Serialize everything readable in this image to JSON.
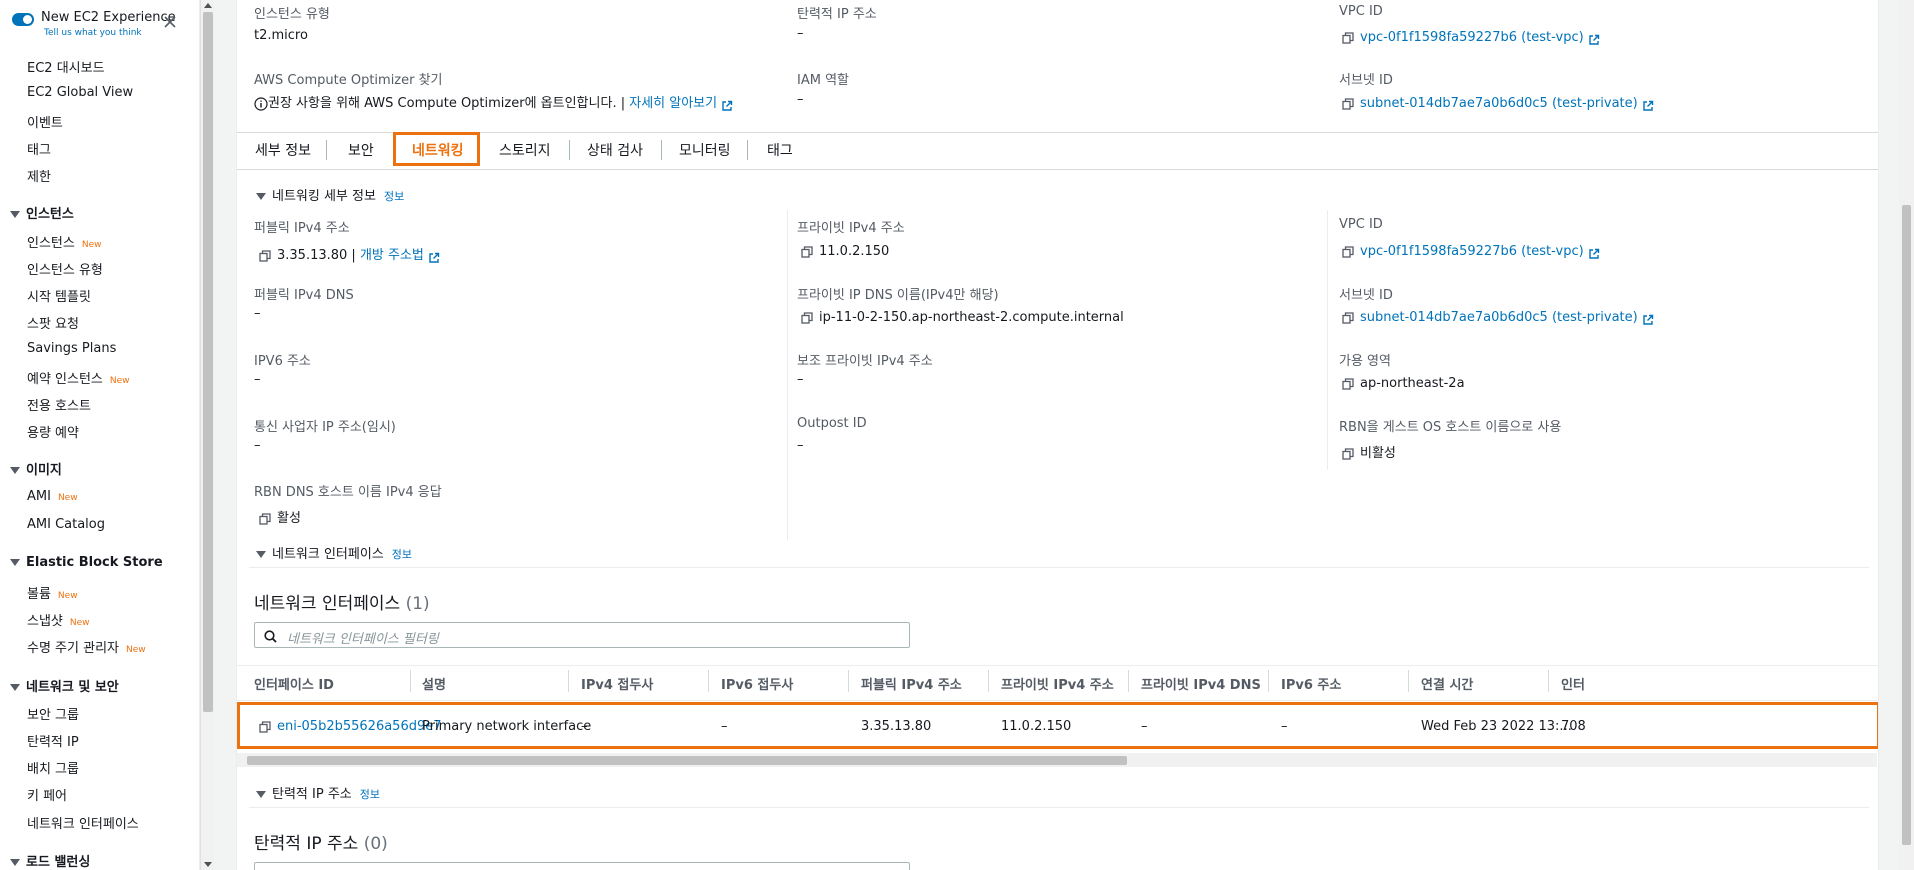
{
  "sidebar": {
    "toggle_title": "New EC2 Experience",
    "toggle_subtitle": "Tell us what you think",
    "items_top": [
      "EC2 대시보드",
      "EC2 Global View",
      "이벤트",
      "태그",
      "제한"
    ],
    "sections": [
      {
        "title": "인스턴스",
        "items": [
          {
            "label": "인스턴스",
            "badge": "New"
          },
          {
            "label": "인스턴스 유형"
          },
          {
            "label": "시작 템플릿"
          },
          {
            "label": "스팟 요청"
          },
          {
            "label": "Savings Plans"
          },
          {
            "label": "예약 인스턴스",
            "badge": "New"
          },
          {
            "label": "전용 호스트"
          },
          {
            "label": "용량 예약"
          }
        ]
      },
      {
        "title": "이미지",
        "items": [
          {
            "label": "AMI",
            "badge": "New"
          },
          {
            "label": "AMI Catalog"
          }
        ]
      },
      {
        "title": "Elastic Block Store",
        "items": [
          {
            "label": "볼륨",
            "badge": "New"
          },
          {
            "label": "스냅샷",
            "badge": "New"
          },
          {
            "label": "수명 주기 관리자",
            "badge": "New"
          }
        ]
      },
      {
        "title": "네트워크 및 보안",
        "items": [
          {
            "label": "보안 그룹"
          },
          {
            "label": "탄력적 IP"
          },
          {
            "label": "배치 그룹"
          },
          {
            "label": "키 페어"
          },
          {
            "label": "네트워크 인터페이스"
          }
        ]
      },
      {
        "title": "로드 밸런싱",
        "items": []
      }
    ]
  },
  "top": {
    "instance_type_label": "인스턴스 유형",
    "instance_type_value": "t2.micro",
    "optimizer_label": "AWS Compute Optimizer 찾기",
    "optimizer_text": "권장 사항을 위해 AWS Compute Optimizer에 옵트인합니다. |",
    "optimizer_link": "자세히 알아보기",
    "elastic_ip_label": "탄력적 IP 주소",
    "elastic_ip_value": "–",
    "iam_label": "IAM 역할",
    "iam_value": "–",
    "vpc_label": "VPC ID",
    "vpc_value": "vpc-0f1f1598fa59227b6 (test-vpc)",
    "subnet_label": "서브넷 ID",
    "subnet_value": "subnet-014db7ae7a0b6d0c5 (test-private)"
  },
  "tabs": [
    "세부 정보",
    "보안",
    "네트워킹",
    "스토리지",
    "상태 검사",
    "모니터링",
    "태그"
  ],
  "active_tab": "네트워킹",
  "networking": {
    "header": "네트워킹 세부 정보",
    "info": "정보",
    "public_ipv4_label": "퍼블릭 IPv4 주소",
    "public_ipv4_value": "3.35.13.80 |",
    "public_ipv4_link": "개방 주소법",
    "public_dns_label": "퍼블릭 IPv4 DNS",
    "public_dns_value": "–",
    "ipv6_label": "IPV6 주소",
    "ipv6_value": "–",
    "carrier_label": "통신 사업자 IP 주소(임시)",
    "carrier_value": "–",
    "rbn_dns_label": "RBN DNS 호스트 이름 IPv4 응답",
    "rbn_dns_value": "활성",
    "private_ipv4_label": "프라이빗 IPv4 주소",
    "private_ipv4_value": "11.0.2.150",
    "private_dns_label": "프라이빗 IP DNS 이름(IPv4만 해당)",
    "private_dns_value": "ip-11-0-2-150.ap-northeast-2.compute.internal",
    "secondary_label": "보조 프라이빗 IPv4 주소",
    "secondary_value": "–",
    "outpost_label": "Outpost ID",
    "outpost_value": "–",
    "vpc_label": "VPC ID",
    "vpc_value": "vpc-0f1f1598fa59227b6 (test-vpc)",
    "subnet_label": "서브넷 ID",
    "subnet_value": "subnet-014db7ae7a0b6d0c5 (test-private)",
    "az_label": "가용 영역",
    "az_value": "ap-northeast-2a",
    "rbn_guest_label": "RBN을 게스트 OS 호스트 이름으로 사용",
    "rbn_guest_value": "비활성"
  },
  "interfaces": {
    "header": "네트워크 인터페이스",
    "info": "정보",
    "title": "네트워크 인터페이스",
    "count": "(1)",
    "filter_placeholder": "네트워크 인터페이스 필터링",
    "columns": [
      "인터페이스 ID",
      "설명",
      "IPv4 접두사",
      "IPv6 접두사",
      "퍼블릭 IPv4 주소",
      "프라이빗 IPv4 주소",
      "프라이빗 IPv4 DNS",
      "IPv6 주소",
      "연결 시간",
      "인터"
    ],
    "row": [
      "eni-05b2b55626a56d9e7",
      "Primary network interface",
      "–",
      "–",
      "3.35.13.80",
      "11.0.2.150",
      "–",
      "–",
      "Wed Feb 23 2022 13:...",
      "708"
    ]
  },
  "elastic": {
    "header": "탄력적 IP 주소",
    "info": "정보",
    "title": "탄력적 IP 주소",
    "count": "(0)"
  },
  "colors": {
    "accent": "#ec7211",
    "link": "#0073bb"
  }
}
